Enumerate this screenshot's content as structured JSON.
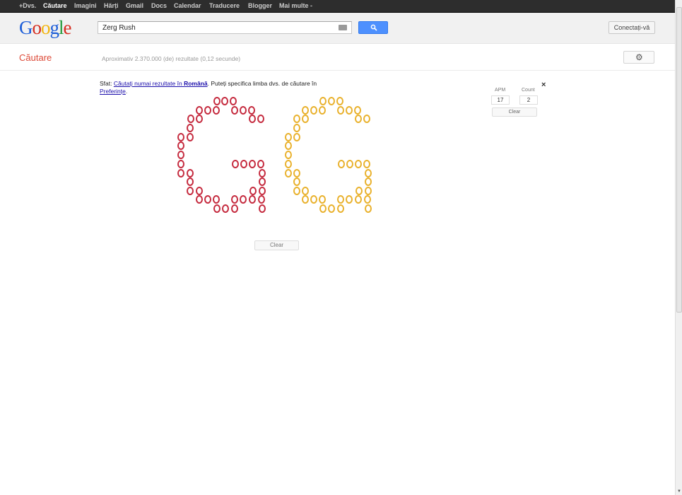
{
  "topbar": {
    "items": [
      {
        "label": "+Dvs.",
        "active": false
      },
      {
        "label": "Căutare",
        "active": true
      },
      {
        "label": "Imagini",
        "active": false
      },
      {
        "label": "Hărți",
        "active": false
      },
      {
        "label": "Gmail",
        "active": false
      },
      {
        "label": "Docs",
        "active": false
      },
      {
        "label": "Calendar",
        "active": false
      },
      {
        "label": "Traducere",
        "active": false
      },
      {
        "label": "Blogger",
        "active": false
      },
      {
        "label": "Mai multe -",
        "active": false
      }
    ]
  },
  "header": {
    "logo": "Google",
    "search_value": "Zerg Rush",
    "signin_label": "Conectați-vă"
  },
  "subheader": {
    "section_title": "Căutare",
    "result_stats": "Aproximativ 2.370.000 (de) rezultate (0,12 secunde)"
  },
  "tip": {
    "prefix": "Sfat: ",
    "link1": "Căutați numai rezultate în ",
    "link1_bold": "Română",
    "middle": ". Puteți specifica limba dvs. de căutare în ",
    "link2": "Preferințe",
    "suffix": "."
  },
  "apm_panel": {
    "apm_label": "APM",
    "apm_value": "17",
    "count_label": "Count",
    "count_value": "2",
    "clear_label": "Clear",
    "close_label": "×"
  },
  "zerg": {
    "colors": {
      "red": "#c52a3e",
      "yellow": "#e9b12c"
    }
  },
  "bottom": {
    "clear_label": "Clear"
  }
}
